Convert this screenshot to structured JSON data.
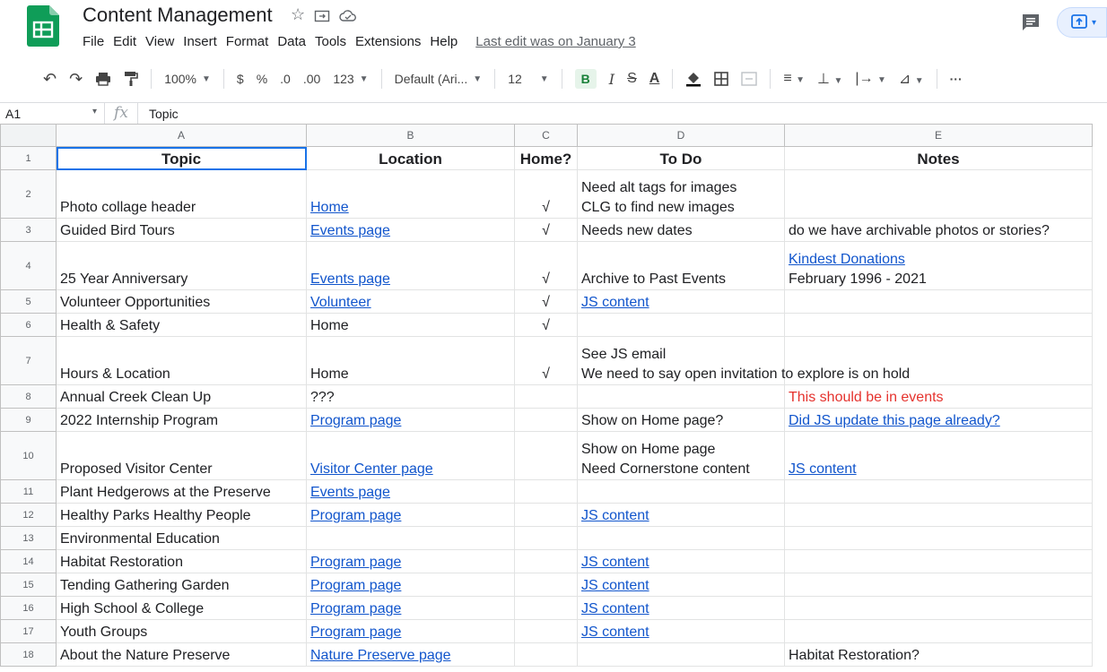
{
  "doc": {
    "title": "Content Management",
    "last_edit": "Last edit was on January 3"
  },
  "menu": [
    "File",
    "Edit",
    "View",
    "Insert",
    "Format",
    "Data",
    "Tools",
    "Extensions",
    "Help"
  ],
  "toolbar": {
    "zoom": "100%",
    "currency": "$",
    "percent": "%",
    "dec_decrease": ".0",
    "dec_increase": ".00",
    "more_formats": "123",
    "font": "Default (Ari...",
    "font_size": "12",
    "bold": "B",
    "italic": "I",
    "strike": "S",
    "text_color": "A",
    "more": "···"
  },
  "formula_bar": {
    "cell_ref": "A1",
    "fx": "fx",
    "value": "Topic"
  },
  "columns": [
    "A",
    "B",
    "C",
    "D",
    "E"
  ],
  "rows": [
    {
      "n": "1",
      "a": "Topic",
      "b": "Location",
      "c": "Home?",
      "d": "To Do",
      "e": "Notes"
    },
    {
      "n": "2",
      "a": "Photo collage header",
      "b": "Home",
      "c": "√",
      "d1": "Need alt tags for images",
      "d2": "CLG to find new images",
      "e": ""
    },
    {
      "n": "3",
      "a": "Guided Bird Tours",
      "b": "Events page",
      "c": "√",
      "d": "Needs new dates",
      "e": "do we have archivable photos or stories?"
    },
    {
      "n": "4",
      "a": "25 Year Anniversary",
      "b": "Events page",
      "c": "√",
      "d": "Archive to Past Events",
      "e1": "Kindest Donations",
      "e2": "February 1996 - 2021"
    },
    {
      "n": "5",
      "a": "Volunteer Opportunities",
      "b": "Volunteer",
      "c": "√",
      "d": "JS content",
      "e": ""
    },
    {
      "n": "6",
      "a": "Health & Safety",
      "b": "Home",
      "c": "√",
      "d": "",
      "e": ""
    },
    {
      "n": "7",
      "a": "Hours & Location",
      "b": "Home",
      "c": "√",
      "d1": "See JS email",
      "d2": "We need to say open invitation to explore is on hold",
      "e": ""
    },
    {
      "n": "8",
      "a": "Annual Creek Clean Up",
      "b": "???",
      "c": "",
      "d": "",
      "e": "This should be in events"
    },
    {
      "n": "9",
      "a": "2022 Internship Program",
      "b": "Program page",
      "c": "",
      "d": "Show on Home page?",
      "e": "Did JS update this page already?"
    },
    {
      "n": "10",
      "a": "Proposed Visitor Center",
      "b": "Visitor Center page",
      "c": "",
      "d1": "Show on Home page",
      "d2": "Need Cornerstone content",
      "e": "JS content"
    },
    {
      "n": "11",
      "a": "Plant Hedgerows at the Preserve",
      "b": "Events page",
      "c": "",
      "d": "",
      "e": ""
    },
    {
      "n": "12",
      "a": "Healthy Parks Healthy People",
      "b": "Program page",
      "c": "",
      "d": "JS content",
      "e": ""
    },
    {
      "n": "13",
      "a": "Environmental Education",
      "b": "",
      "c": "",
      "d": "",
      "e": ""
    },
    {
      "n": "14",
      "a": "Habitat Restoration",
      "b": "Program page",
      "c": "",
      "d": "JS content",
      "e": ""
    },
    {
      "n": "15",
      "a": "Tending Gathering Garden",
      "b": "Program page",
      "c": "",
      "d": "JS content",
      "e": ""
    },
    {
      "n": "16",
      "a": "High School & College",
      "b": "Program page",
      "c": "",
      "d": "JS content",
      "e": ""
    },
    {
      "n": "17",
      "a": "Youth Groups",
      "b": "Program page",
      "c": "",
      "d": "JS content",
      "e": ""
    },
    {
      "n": "18",
      "a": "About the Nature Preserve",
      "b": "Nature Preserve page",
      "c": "",
      "d": "",
      "e": "Habitat Restoration?"
    }
  ],
  "colors": {
    "link": "#1155cc",
    "warning": "#e5322d",
    "selection": "#1a73e8",
    "sheets_green": "#0f9d58"
  }
}
